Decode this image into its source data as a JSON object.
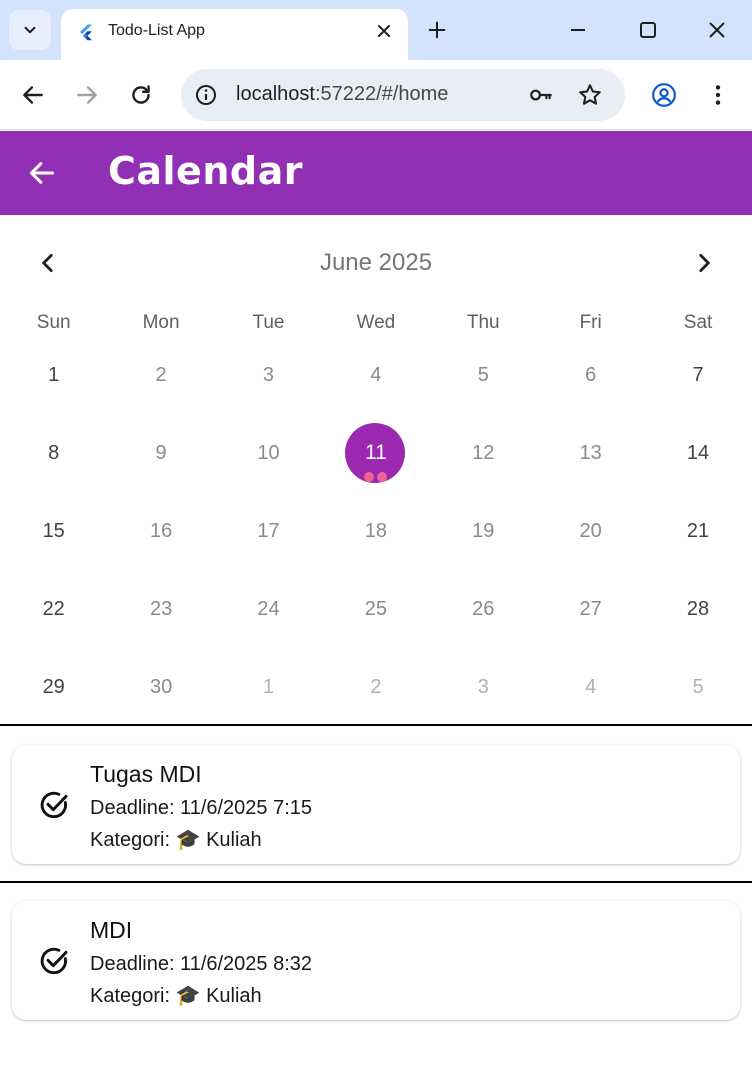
{
  "browser": {
    "tab_title": "Todo-List App",
    "url_host": "localhost",
    "url_path": ":57222/#/home"
  },
  "app": {
    "title": "Calendar",
    "accent": "#9230b5"
  },
  "calendar": {
    "month_label": "June 2025",
    "weekdays": [
      "Sun",
      "Mon",
      "Tue",
      "Wed",
      "Thu",
      "Fri",
      "Sat"
    ],
    "weeks": [
      [
        "1",
        "2",
        "3",
        "4",
        "5",
        "6",
        "7"
      ],
      [
        "8",
        "9",
        "10",
        "11",
        "12",
        "13",
        "14"
      ],
      [
        "15",
        "16",
        "17",
        "18",
        "19",
        "20",
        "21"
      ],
      [
        "22",
        "23",
        "24",
        "25",
        "26",
        "27",
        "28"
      ],
      [
        "29",
        "30",
        "1",
        "2",
        "3",
        "4",
        "5"
      ]
    ],
    "selected_day": "11",
    "event_markers_on_selected": 2
  },
  "tasks": [
    {
      "title": "Tugas MDI",
      "deadline": "Deadline: 11/6/2025 7:15",
      "category": "Kategori: 🎓 Kuliah"
    },
    {
      "title": "MDI",
      "deadline": "Deadline: 11/6/2025 8:32",
      "category": "Kategori: 🎓 Kuliah"
    }
  ]
}
